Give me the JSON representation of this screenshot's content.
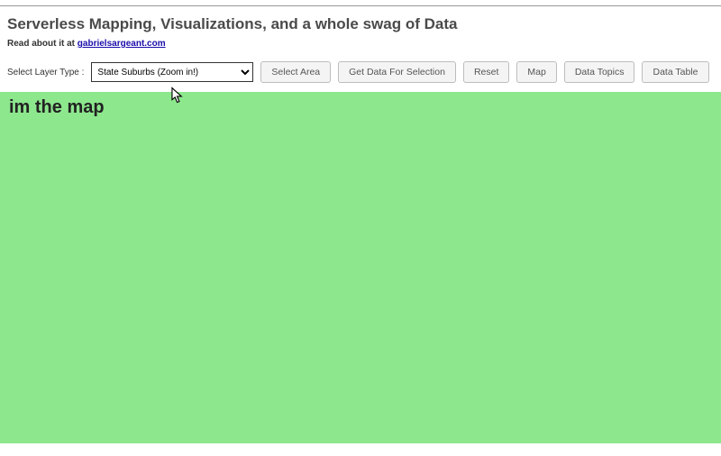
{
  "header": {
    "title": "Serverless Mapping, Visualizations, and a whole swag of Data",
    "subhead_prefix": "Read about it at ",
    "subhead_link_text": "gabrielsargeant.com"
  },
  "toolbar": {
    "label": "Select Layer Type :",
    "selected_layer": "State Suburbs (Zoom in!)",
    "buttons": {
      "select_area": "Select Area",
      "get_data": "Get Data For Selection",
      "reset": "Reset",
      "map": "Map",
      "data_topics": "Data Topics",
      "data_table": "Data Table"
    }
  },
  "map": {
    "placeholder_text": "im the map"
  }
}
